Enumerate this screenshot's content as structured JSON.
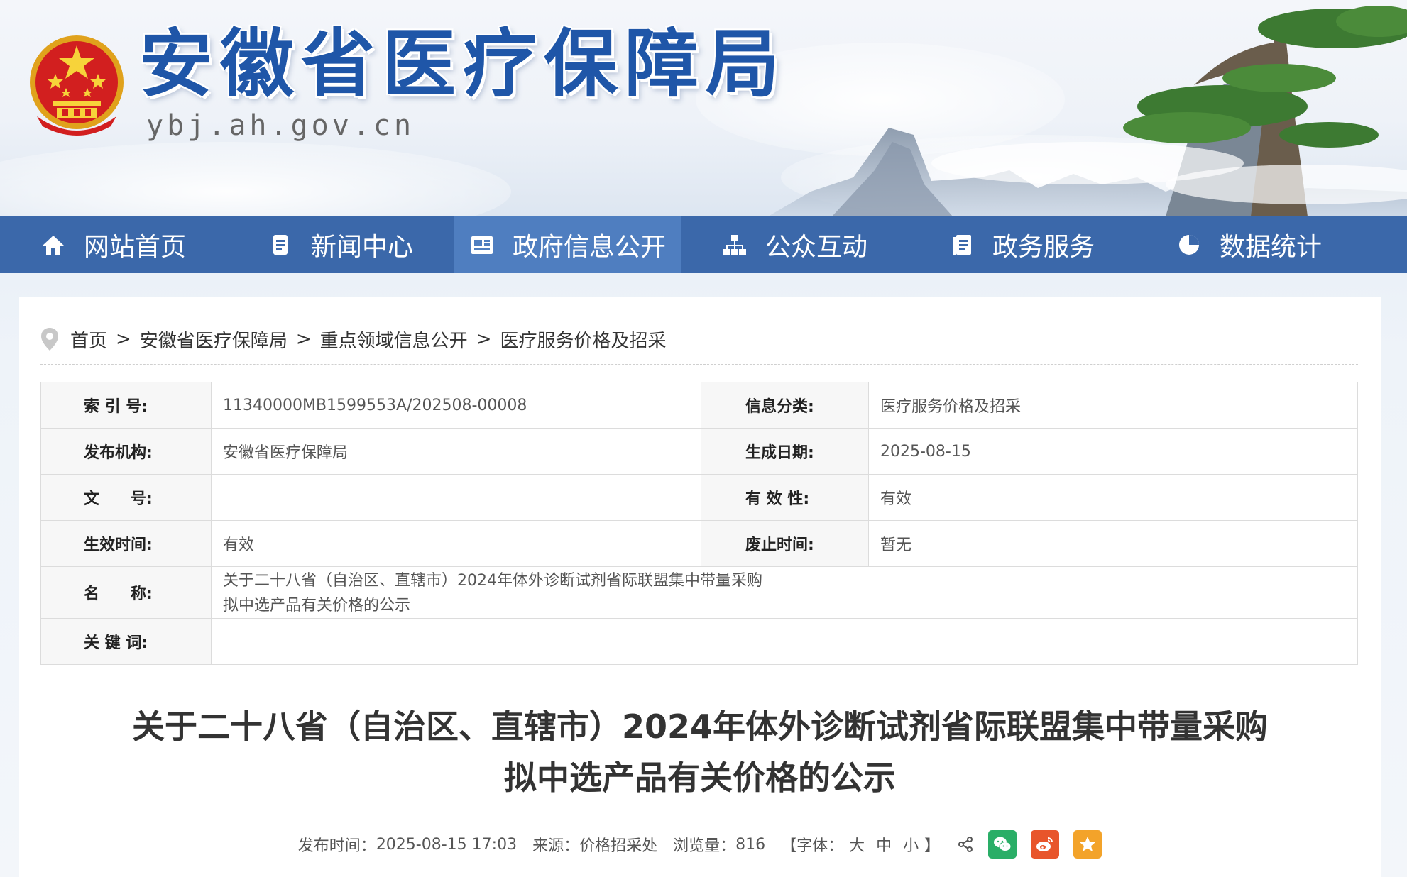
{
  "header": {
    "site_title": "安徽省医疗保障局",
    "site_domain": "ybj.ah.gov.cn",
    "brand_color": "#1f56a8"
  },
  "nav": {
    "items": [
      {
        "label": "网站首页",
        "icon": "home-icon"
      },
      {
        "label": "新闻中心",
        "icon": "document-icon"
      },
      {
        "label": "政府信息公开",
        "icon": "newspaper-icon",
        "active": true
      },
      {
        "label": "公众互动",
        "icon": "sitemap-icon"
      },
      {
        "label": "政务服务",
        "icon": "clipboard-icon"
      },
      {
        "label": "数据统计",
        "icon": "pie-chart-icon"
      }
    ],
    "bg_color": "#3b68aa",
    "active_color": "#4f7ec0"
  },
  "breadcrumb": {
    "items": [
      "首页",
      "安徽省医疗保障局",
      "重点领域信息公开",
      "医疗服务价格及招采"
    ],
    "separator": ">"
  },
  "info": {
    "index_label": "索 引 号:",
    "index_value": "11340000MB1599553A/202508-00008",
    "category_label": "信息分类:",
    "category_value": "医疗服务价格及招采",
    "publisher_label": "发布机构:",
    "publisher_value": "安徽省医疗保障局",
    "date_label": "生成日期:",
    "date_value": "2025-08-15",
    "docno_label": "文　　号:",
    "docno_value": "",
    "validity_label": "有 效 性:",
    "validity_value": "有效",
    "effective_label": "生效时间:",
    "effective_value": "有效",
    "expire_label": "废止时间:",
    "expire_value": "暂无",
    "name_label": "名　　称:",
    "name_line1": "关于二十八省（自治区、直辖市）2024年体外诊断试剂省际联盟集中带量采购",
    "name_line2": "拟中选产品有关价格的公示",
    "keywords_label": "关 键 词:",
    "keywords_value": ""
  },
  "article": {
    "title_line1": "关于二十八省（自治区、直辖市）2024年体外诊断试剂省际联盟集中带量采购",
    "title_line2": "拟中选产品有关价格的公示",
    "publish_label": "发布时间：",
    "publish_time": "2025-08-15 17:03",
    "source_label": "来源：",
    "source": "价格招采处",
    "views_label": "浏览量：",
    "views": "816",
    "font_open": "【字体：",
    "font_large": "大",
    "font_medium": "中",
    "font_small": "小",
    "font_close": "】",
    "share_icons": [
      "share-icon",
      "wechat-icon",
      "weibo-icon",
      "favorite-icon"
    ],
    "wechat_color": "#2aae67",
    "weibo_color": "#e8552b",
    "favorite_color": "#f3a32a"
  }
}
